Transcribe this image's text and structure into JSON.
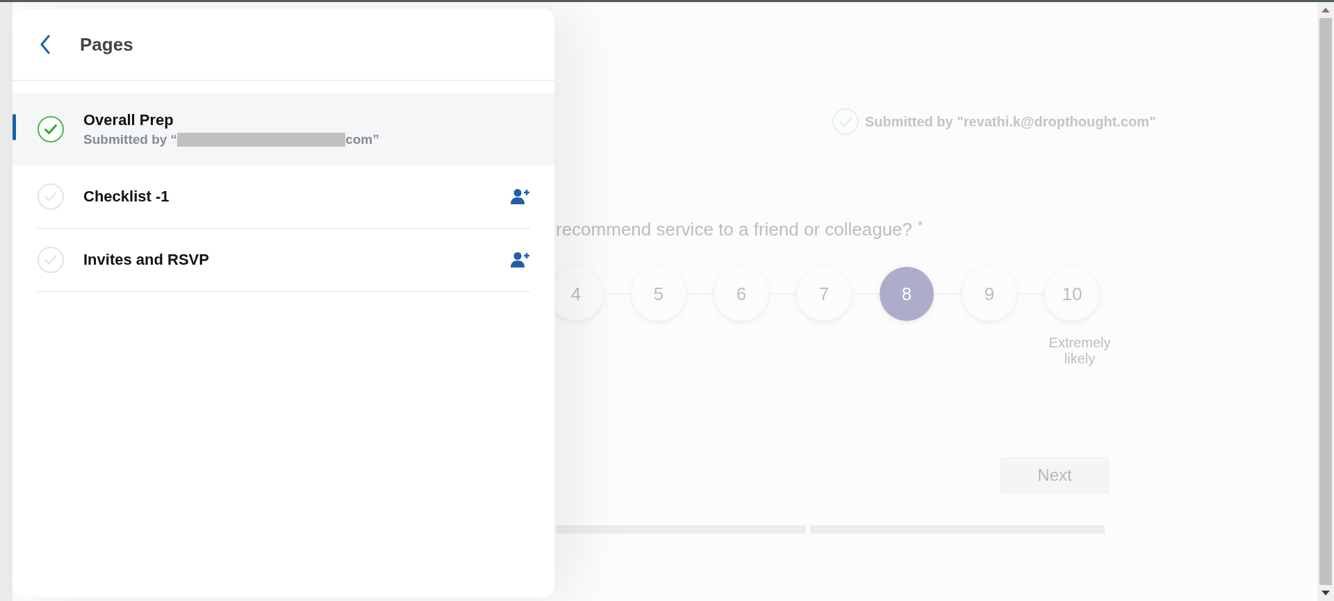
{
  "panel": {
    "title": "Pages",
    "items": [
      {
        "title": "Overall Prep",
        "selected": true,
        "completed": true,
        "assignable": false,
        "subtitle_prefix": "Submitted by “",
        "redacted": true,
        "subtitle_suffix": "com”"
      },
      {
        "title": "Checklist -1",
        "selected": false,
        "completed": false,
        "assignable": true
      },
      {
        "title": "Invites and RSVP",
        "selected": false,
        "completed": false,
        "assignable": true
      }
    ]
  },
  "survey": {
    "submitted_by": "Submitted by \"revathi.k@dropthought.com\"",
    "question": "recommend service to a friend or colleague?",
    "required_mark": "*",
    "scale": [
      {
        "label": "4",
        "selected": false
      },
      {
        "label": "5",
        "selected": false
      },
      {
        "label": "6",
        "selected": false
      },
      {
        "label": "7",
        "selected": false
      },
      {
        "label": "8",
        "selected": true
      },
      {
        "label": "9",
        "selected": false
      },
      {
        "label": "10",
        "selected": false
      }
    ],
    "high_label": "Extremely likely",
    "next_button": "Next"
  }
}
